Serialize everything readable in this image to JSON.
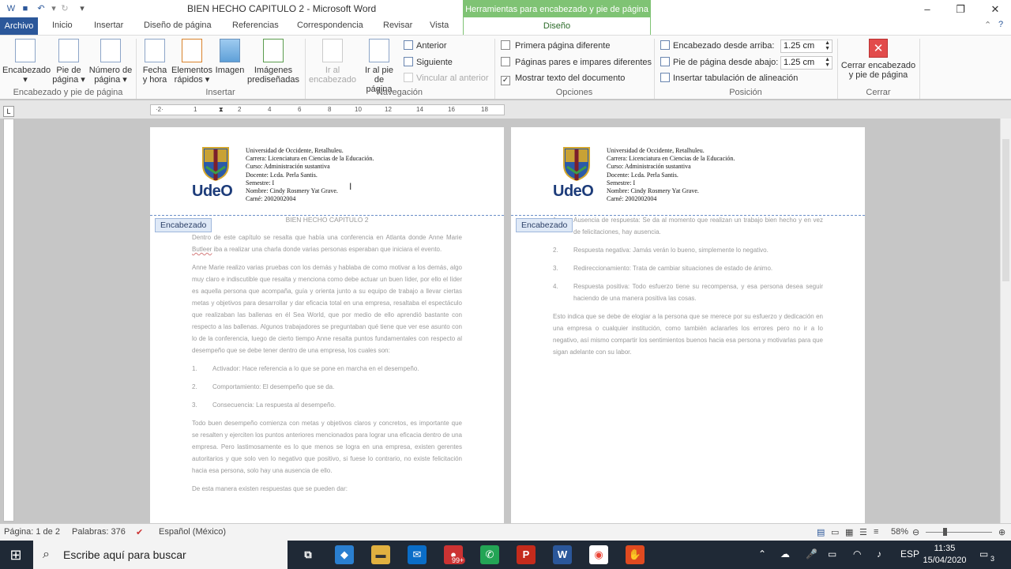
{
  "window": {
    "title": "BIEN HECHO CAPITULO 2  -  Microsoft Word",
    "context_title": "Herramientas para encabezado y pie de página",
    "controls": [
      "–",
      "❐",
      "✕"
    ]
  },
  "tabs": {
    "archivo": "Archivo",
    "items": [
      "Inicio",
      "Insertar",
      "Diseño de página",
      "Referencias",
      "Correspondencia",
      "Revisar",
      "Vista"
    ],
    "context": "Diseño"
  },
  "ribbon": {
    "groups": {
      "hf": "Encabezado y pie de página",
      "insertar": "Insertar",
      "navegacion": "Navegación",
      "opciones": "Opciones",
      "posicion": "Posición",
      "cerrar": "Cerrar"
    },
    "encabezado": {
      "line1": "Encabezado",
      "line2": "▾"
    },
    "pie": {
      "line1": "Pie de",
      "line2": "página ▾"
    },
    "numero": {
      "line1": "Número de",
      "line2": "página ▾"
    },
    "fecha": {
      "line1": "Fecha",
      "line2": "y hora"
    },
    "elementos": {
      "line1": "Elementos",
      "line2": "rápidos ▾"
    },
    "imagen": {
      "line1": "Imagen",
      "line2": ""
    },
    "imagenes": {
      "line1": "Imágenes",
      "line2": "prediseñadas"
    },
    "ir_enc": {
      "line1": "Ir al",
      "line2": "encabezado"
    },
    "ir_pie": {
      "line1": "Ir al pie",
      "line2": "de página"
    },
    "anterior": "Anterior",
    "siguiente": "Siguiente",
    "vincular": "Vincular al anterior",
    "primera": "Primera página diferente",
    "pares": "Páginas pares e impares diferentes",
    "mostrar": "Mostrar texto del documento",
    "mostrar_checked": "✓",
    "enc_arriba": "Encabezado desde arriba:",
    "enc_arriba_val": "1.25 cm",
    "pie_abajo": "Pie de página desde abajo:",
    "pie_abajo_val": "1.25 cm",
    "tabulacion": "Insertar tabulación de alineación",
    "cerrar_btn": {
      "line1": "Cerrar encabezado",
      "line2": "y pie de página"
    }
  },
  "ruler_ticks": [
    "·2·",
    "1",
    "·2·",
    "1",
    "2",
    "4",
    "6",
    "8",
    "10",
    "12",
    "14",
    "16",
    "18"
  ],
  "header": {
    "logo_text": "UdeO",
    "lines": [
      "Universidad de Occidente, Retalhuleu.",
      "Carrera:  Licenciatura en Ciencias de la Educación.",
      "Curso: Administración sustantiva",
      "Docente: Lcda. Perla Santis.",
      "Semestre: I",
      "Nombre: Cindy Rosmery Yat Grave.",
      "Carné: 2002002004"
    ],
    "tag": "Encabezado"
  },
  "page1": {
    "title": "BIEN HECHO CAPITULO 2",
    "p1": "Dentro de este capítulo se resalta que había una conferencia en Atlanta donde Anne Marie",
    "p1_misspelled": "Butleer",
    "p1_rest": "iba a realizar una charla donde varias personas esperaban que iniciara el evento.",
    "p2": "Anne Marie realizo varias pruebas con los demás y hablaba de como motivar a los demás, algo muy claro e indiscutible que resalta y menciona como debe actuar un buen líder, por ello el líder es aquella persona que acompaña, guía y orienta junto a su equipo de trabajo a llevar ciertas metas y objetivos para desarrollar y dar eficacia total en una empresa, resaltaba el espectáculo que realizaban las ballenas en él Sea World, que por medio de ello aprendió bastante con respecto a las ballenas. Algunos trabajadores se preguntaban qué tiene que ver ese asunto con lo de la conferencia, luego de cierto tiempo Anne resalta puntos fundamentales con respecto al desempeño que se debe tener dentro de una empresa, los cuales son:",
    "list": [
      {
        "n": "1.",
        "t": "Activador: Hace referencia a lo que se pone en marcha en el desempeño."
      },
      {
        "n": "2.",
        "t": "Comportamiento: El desempeño que se da."
      },
      {
        "n": "3.",
        "t": "Consecuencia: La respuesta al desempeño."
      }
    ],
    "p3": "Todo buen desempeño comienza con metas y objetivos claros y concretos, es importante que se resalten y ejerciten los puntos anteriores mencionados  para lograr una eficacia dentro de una empresa. Pero lastimosamente es lo que menos se logra en una empresa, existen gerentes autoritarios y que solo ven lo negativo que positivo, si fuese lo contrario, no existe felicitación hacia esa persona, solo hay una ausencia de ello.",
    "p4": "De esta manera existen respuestas que se pueden dar:"
  },
  "page2": {
    "list": [
      {
        "n": "1.",
        "t": "Ausencia de respuesta: Se da al momento que realizan un trabajo bien hecho y en vez de felicitaciones, hay ausencia."
      },
      {
        "n": "2.",
        "t": "Respuesta negativa: Jamás verán lo bueno, simplemente lo negativo."
      },
      {
        "n": "3.",
        "t": "Redireccionamiento: Trata de cambiar situaciones de estado de ánimo."
      },
      {
        "n": "4.",
        "t": "Respuesta positiva: Todo esfuerzo tiene su recompensa, y esa persona desea seguir haciendo de una manera  positiva las cosas."
      }
    ],
    "p1": "Esto indica que se debe de elogiar a la persona que se merece por su esfuerzo y dedicación en una empresa o cualquier institución, como también aclararles los errores pero no ir a lo negativo, así mismo compartir los sentimientos buenos hacia esa persona y motivarlas para que sigan adelante con su labor."
  },
  "status": {
    "page": "Página: 1 de 2",
    "words": "Palabras: 376",
    "lang": "Español (México)",
    "zoom": "58%"
  },
  "taskbar": {
    "search_placeholder": "Escribe aquí para buscar",
    "badge": "99+",
    "lang": "ESP",
    "time": "11:35",
    "date": "15/04/2020",
    "notif": "3"
  }
}
